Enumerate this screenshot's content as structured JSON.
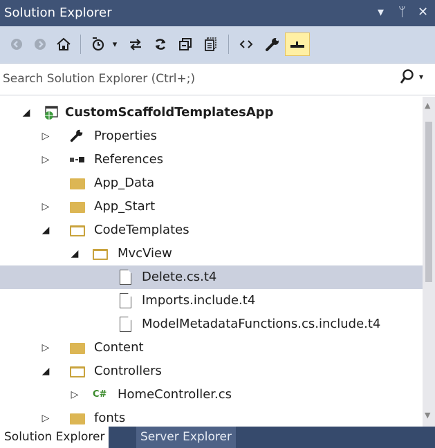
{
  "window": {
    "title": "Solution Explorer",
    "controls": {
      "dropdown": "▾",
      "pin": "ᛘ",
      "close": "✕"
    }
  },
  "toolbar": {
    "buttons": [
      {
        "name": "back-button",
        "glyph": "◀",
        "icon": "back-icon",
        "enabled": false
      },
      {
        "name": "forward-button",
        "glyph": "▶",
        "icon": "forward-icon",
        "enabled": false
      },
      {
        "name": "home-button",
        "glyph": "⌂",
        "icon": "home-icon",
        "enabled": true
      },
      {
        "name": "pending-changes-filter-button",
        "glyph": "ō",
        "icon": "pending-changes-icon",
        "enabled": true
      },
      {
        "name": "sync-active-document-button",
        "glyph": "⇄",
        "icon": "sync-icon",
        "enabled": true
      },
      {
        "name": "refresh-button",
        "glyph": "↻",
        "icon": "refresh-icon",
        "enabled": true
      },
      {
        "name": "collapse-all-button",
        "glyph": "⧉",
        "icon": "collapse-all-icon",
        "enabled": true
      },
      {
        "name": "show-all-files-button",
        "glyph": "▤",
        "icon": "show-all-files-icon",
        "enabled": true
      },
      {
        "name": "view-code-button",
        "glyph": "‹›",
        "icon": "code-icon",
        "enabled": true
      },
      {
        "name": "properties-button",
        "glyph": "🔧",
        "icon": "wrench-icon",
        "enabled": true
      },
      {
        "name": "preview-selected-items-button",
        "glyph": "▬",
        "icon": "preview-icon",
        "enabled": true,
        "active": true
      }
    ]
  },
  "search": {
    "placeholder": "Search Solution Explorer (Ctrl+;)",
    "value": ""
  },
  "tree": {
    "items": [
      {
        "label": "CustomScaffoldTemplatesApp",
        "level": 0,
        "expander": "expanded",
        "icon": "web-project-icon",
        "bold": true
      },
      {
        "label": "Properties",
        "level": 1,
        "expander": "collapsed",
        "icon": "wrench-icon"
      },
      {
        "label": "References",
        "level": 1,
        "expander": "collapsed",
        "icon": "references-icon"
      },
      {
        "label": "App_Data",
        "level": 1,
        "expander": "none",
        "icon": "folder-icon"
      },
      {
        "label": "App_Start",
        "level": 1,
        "expander": "collapsed",
        "icon": "folder-icon"
      },
      {
        "label": "CodeTemplates",
        "level": 1,
        "expander": "expanded",
        "icon": "folder-open-icon"
      },
      {
        "label": "MvcView",
        "level": 2,
        "expander": "expanded",
        "icon": "folder-open-icon"
      },
      {
        "label": "Delete.cs.t4",
        "level": 3,
        "expander": "none",
        "icon": "file-icon",
        "selected": true
      },
      {
        "label": "Imports.include.t4",
        "level": 3,
        "expander": "none",
        "icon": "file-icon"
      },
      {
        "label": "ModelMetadataFunctions.cs.include.t4",
        "level": 3,
        "expander": "none",
        "icon": "file-icon"
      },
      {
        "label": "Content",
        "level": 1,
        "expander": "collapsed",
        "icon": "folder-icon"
      },
      {
        "label": "Controllers",
        "level": 1,
        "expander": "expanded",
        "icon": "folder-open-icon"
      },
      {
        "label": "HomeController.cs",
        "level": 2,
        "expander": "collapsed",
        "icon": "csharp-file-icon"
      },
      {
        "label": "fonts",
        "level": 1,
        "expander": "collapsed",
        "icon": "folder-icon"
      }
    ]
  },
  "csharp_badge": "C#",
  "tabs": [
    {
      "label": "Solution Explorer",
      "active": true
    },
    {
      "label": "Server Explorer",
      "active": false
    }
  ],
  "colors": {
    "titlebar": "#3f5376",
    "toolbar": "#ced8e8",
    "selection": "#cbd0de",
    "folder": "#dcb654",
    "tabbar": "#364a6c"
  }
}
